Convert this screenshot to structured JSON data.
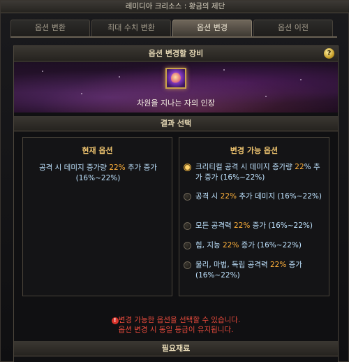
{
  "window": {
    "title": "레미디아 크리소스 : 황금의 제단"
  },
  "tabs": [
    {
      "label": "옵션 변환",
      "active": false
    },
    {
      "label": "최대 수치 변환",
      "active": false
    },
    {
      "label": "옵션 변경",
      "active": true
    },
    {
      "label": "옵션 이전",
      "active": false
    }
  ],
  "equipment_section": {
    "title": "옵션 변경할 장비",
    "help_label": "?",
    "item_name": "차원을 지나는 자의 인장",
    "item_icon": "purple-orb-seal-icon"
  },
  "result_section": {
    "title": "결과 선택"
  },
  "current_option": {
    "title": "현재 옵션",
    "parts": [
      "공격 시 데미지 증가량 ",
      "22%",
      " 추가 증가 (16%~22%)"
    ]
  },
  "changeable_options": {
    "title": "변경 가능 옵션",
    "options": [
      {
        "parts": [
          "크리티컬 공격 시 데미지 증가량 ",
          "22",
          "% 추가 증가 (16%~22%)"
        ],
        "selected": true
      },
      {
        "parts": [
          "공격 시 ",
          "22%",
          " 추가 데미지 (16%~22%)"
        ],
        "selected": false
      },
      {
        "parts": [
          "모든 공격력 ",
          "22%",
          " 증가 (16%~22%)"
        ],
        "selected": false
      },
      {
        "parts": [
          "힘, 지능 ",
          "22%",
          " 증가 (16%~22%)"
        ],
        "selected": false
      },
      {
        "parts": [
          "물리, 마법, 독립 공격력 ",
          "22%",
          " 증가 (16%~22%)"
        ],
        "selected": false
      }
    ]
  },
  "notice": {
    "icon_glyph": "!",
    "line1": "변경 가능한 옵션을 선택할 수 있습니다.",
    "line2": "옵션 변경 시 동일 등급이 유지됩니다."
  },
  "materials_section": {
    "title": "필요재료"
  },
  "colors": {
    "highlight": "#ffb13b",
    "option_text": "#bfe3ff",
    "title_gold": "#ecc26e",
    "warning": "#e84a3c"
  }
}
